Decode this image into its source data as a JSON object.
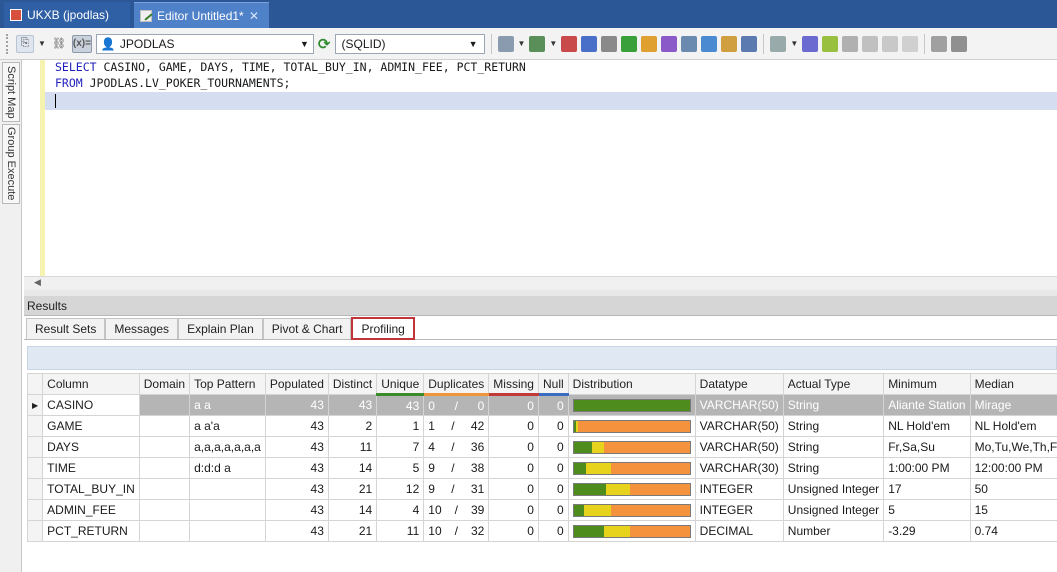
{
  "tabs": [
    {
      "label": "UKXB (jpodlas)",
      "active": false
    },
    {
      "label": "Editor Untitled1*",
      "active": true
    }
  ],
  "toolbar": {
    "connection": "JPODLAS",
    "schema": "(SQLID)",
    "var_label": "(x)="
  },
  "side_tabs": [
    "Script Map",
    "Group Execute"
  ],
  "editor": {
    "line1_kw": "SELECT",
    "line1_rest": " CASINO, GAME, DAYS, TIME, TOTAL_BUY_IN, ADMIN_FEE, PCT_RETURN",
    "line2_kw": "FROM",
    "line2_rest": " JPODLAS.LV_POKER_TOURNAMENTS;"
  },
  "results": {
    "header": "Results",
    "tabs": [
      "Result Sets",
      "Messages",
      "Explain Plan",
      "Pivot & Chart",
      "Profiling"
    ],
    "active_tab": "Profiling"
  },
  "grid": {
    "columns": [
      "Column",
      "Domain",
      "Top Pattern",
      "Populated",
      "Distinct",
      "Unique",
      "Duplicates",
      "Missing",
      "Null",
      "Distribution",
      "Datatype",
      "Actual Type",
      "Minimum",
      "Median"
    ],
    "rows": [
      {
        "column": "CASINO",
        "domain": "",
        "pattern": "a a",
        "populated": "43",
        "distinct": "43",
        "unique": "43",
        "dup_a": "0",
        "dup_b": "0",
        "missing": "0",
        "null": "0",
        "dist": [
          1.0,
          0.0,
          0.0
        ],
        "datatype": "VARCHAR(50)",
        "actual": "String",
        "min": "Aliante Station",
        "median": "Mirage",
        "selected": true
      },
      {
        "column": "GAME",
        "domain": "",
        "pattern": "a a'a",
        "populated": "43",
        "distinct": "2",
        "unique": "1",
        "dup_a": "1",
        "dup_b": "42",
        "missing": "0",
        "null": "0",
        "dist": [
          0.02,
          0.02,
          0.96
        ],
        "datatype": "VARCHAR(50)",
        "actual": "String",
        "min": "NL Hold'em",
        "median": "NL Hold'em",
        "selected": false
      },
      {
        "column": "DAYS",
        "domain": "",
        "pattern": "a,a,a,a,a,a,a",
        "populated": "43",
        "distinct": "11",
        "unique": "7",
        "dup_a": "4",
        "dup_b": "36",
        "missing": "0",
        "null": "0",
        "dist": [
          0.16,
          0.1,
          0.74
        ],
        "datatype": "VARCHAR(50)",
        "actual": "String",
        "min": "Fr,Sa,Su",
        "median": "Mo,Tu,We,Th,Fr,Sa,Su",
        "selected": false
      },
      {
        "column": "TIME",
        "domain": "",
        "pattern": "d:d:d a",
        "populated": "43",
        "distinct": "14",
        "unique": "5",
        "dup_a": "9",
        "dup_b": "38",
        "missing": "0",
        "null": "0",
        "dist": [
          0.11,
          0.21,
          0.68
        ],
        "datatype": "VARCHAR(30)",
        "actual": "String",
        "min": "1:00:00 PM",
        "median": "12:00:00 PM",
        "selected": false
      },
      {
        "column": "TOTAL_BUY_IN",
        "domain": "",
        "pattern": "",
        "populated": "43",
        "distinct": "21",
        "unique": "12",
        "dup_a": "9",
        "dup_b": "31",
        "missing": "0",
        "null": "0",
        "dist": [
          0.28,
          0.21,
          0.51
        ],
        "datatype": "INTEGER",
        "actual": "Unsigned Integer",
        "min": "17",
        "median": "50",
        "selected": false
      },
      {
        "column": "ADMIN_FEE",
        "domain": "",
        "pattern": "",
        "populated": "43",
        "distinct": "14",
        "unique": "4",
        "dup_a": "10",
        "dup_b": "39",
        "missing": "0",
        "null": "0",
        "dist": [
          0.09,
          0.23,
          0.68
        ],
        "datatype": "INTEGER",
        "actual": "Unsigned Integer",
        "min": "5",
        "median": "15",
        "selected": false
      },
      {
        "column": "PCT_RETURN",
        "domain": "",
        "pattern": "",
        "populated": "43",
        "distinct": "21",
        "unique": "11",
        "dup_a": "10",
        "dup_b": "32",
        "missing": "0",
        "null": "0",
        "dist": [
          0.26,
          0.23,
          0.51
        ],
        "datatype": "DECIMAL",
        "actual": "Number",
        "min": "-3.29",
        "median": "0.74",
        "selected": false
      }
    ]
  },
  "colors": {
    "titlebar": "#2b5797",
    "dist_unique": "#4e8c1e",
    "dist_mid": "#e7d21c",
    "dist_dup": "#f5923e",
    "active_tab_outline": "#c0343a"
  }
}
